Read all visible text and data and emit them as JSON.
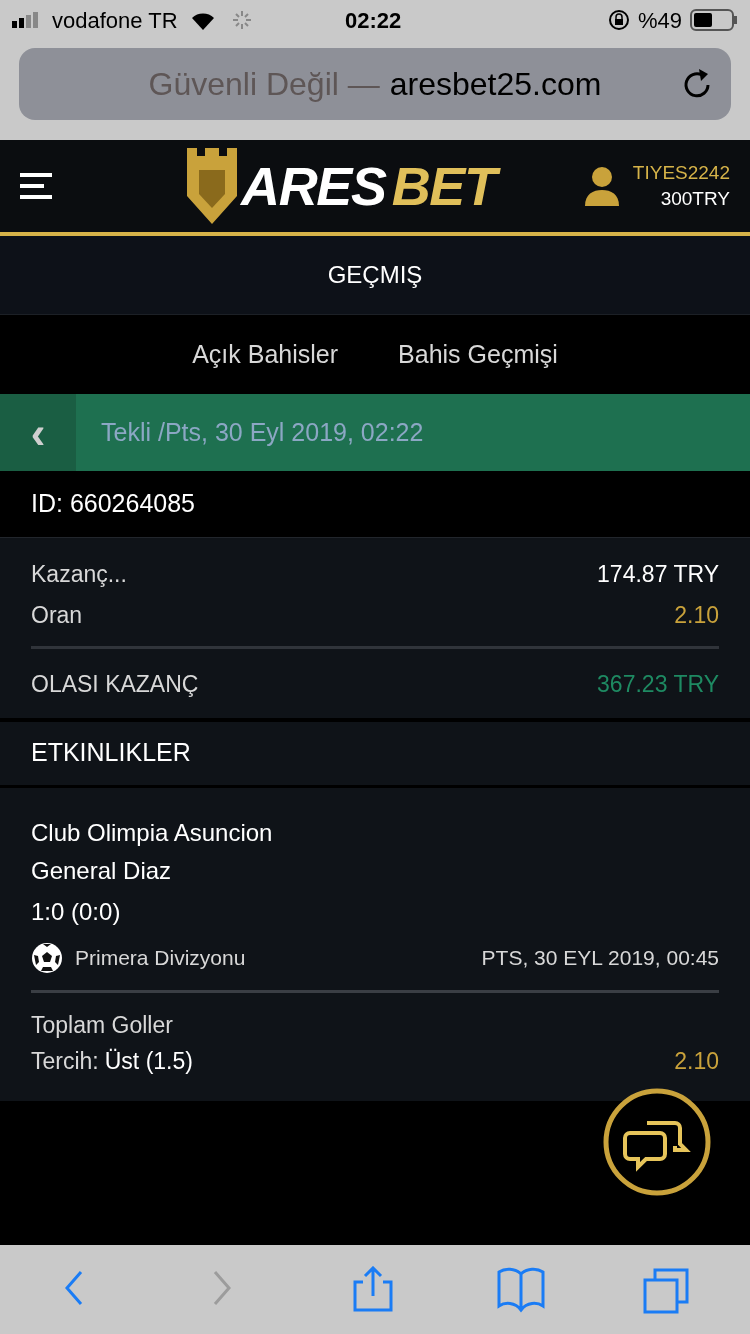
{
  "status_bar": {
    "carrier": "vodafone TR",
    "time": "02:22",
    "battery": "%49"
  },
  "address_bar": {
    "security": "Güvenli Değil —",
    "domain": "aresbet25.com"
  },
  "header": {
    "logo_left": "ARES",
    "logo_right": "BET",
    "username": "TIYES2242",
    "balance": "300TRY"
  },
  "page_title": "GEÇMIŞ",
  "tabs": [
    {
      "label": "Açık Bahisler",
      "selected": false
    },
    {
      "label": "Bahis Geçmişi",
      "selected": false
    }
  ],
  "bet_header": {
    "back": "‹",
    "title": "Tekli /Pts, 30 Eyl 2019, 02:22"
  },
  "bet_id": "ID: 660264085",
  "summary": [
    {
      "label": "Kazanç...",
      "value": "174.87 TRY",
      "kind": "plain"
    },
    {
      "label": "Oran",
      "value": "2.10",
      "kind": "odds"
    },
    {
      "label": "OLASI KAZANÇ",
      "value": "367.23 TRY",
      "kind": "win"
    }
  ],
  "events_title": "ETKINLIKLER",
  "event": {
    "home": "Club Olimpia Asuncion",
    "away": "General Diaz",
    "score": "1:0 (0:0)",
    "league": "Primera Divizyonu",
    "date": "PTS, 30 EYL 2019, 00:45",
    "market": "Toplam Goller",
    "pick_label": "Tercih:",
    "pick": "Üst (1.5)",
    "odds": "2.10"
  },
  "toolbar": [
    {
      "kind": "back",
      "disabled": false
    },
    {
      "kind": "forward",
      "disabled": true
    },
    {
      "kind": "share",
      "disabled": false
    },
    {
      "kind": "bookmarks",
      "disabled": false
    },
    {
      "kind": "tabs",
      "disabled": false
    }
  ]
}
